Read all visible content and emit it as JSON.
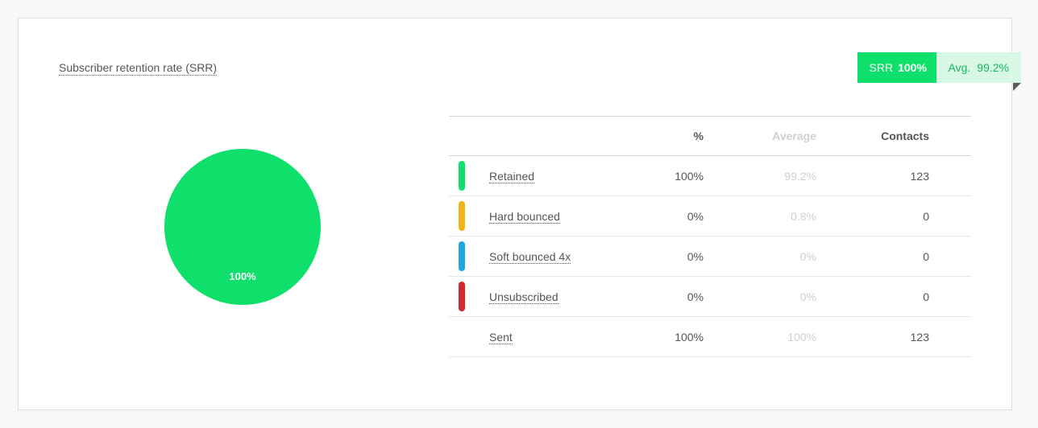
{
  "card": {
    "title": "Subscriber retention rate (SRR)"
  },
  "badge": {
    "srr_label": "SRR",
    "srr_value": "100%",
    "avg_label": "Avg.",
    "avg_value": "99.2%"
  },
  "pie": {
    "label": "100%",
    "color": "#0ee06b"
  },
  "table": {
    "headers": {
      "pct": "%",
      "avg": "Average",
      "contacts": "Contacts"
    },
    "rows": [
      {
        "name": "Retained",
        "pct": "100%",
        "avg": "99.2%",
        "contacts": "123",
        "color": "#0ee06b"
      },
      {
        "name": "Hard bounced",
        "pct": "0%",
        "avg": "0.8%",
        "contacts": "0",
        "color": "#f0b416"
      },
      {
        "name": "Soft bounced 4x",
        "pct": "0%",
        "avg": "0%",
        "contacts": "0",
        "color": "#1ea8e0"
      },
      {
        "name": "Unsubscribed",
        "pct": "0%",
        "avg": "0%",
        "contacts": "0",
        "color": "#d3282f"
      },
      {
        "name": "Sent",
        "pct": "100%",
        "avg": "100%",
        "contacts": "123",
        "color": ""
      }
    ]
  },
  "chart_data": {
    "type": "pie",
    "categories": [
      "Retained",
      "Hard bounced",
      "Soft bounced 4x",
      "Unsubscribed"
    ],
    "values": [
      100,
      0,
      0,
      0
    ],
    "colors": [
      "#0ee06b",
      "#f0b416",
      "#1ea8e0",
      "#d3282f"
    ],
    "title": "",
    "data_labels": [
      "100%"
    ]
  }
}
